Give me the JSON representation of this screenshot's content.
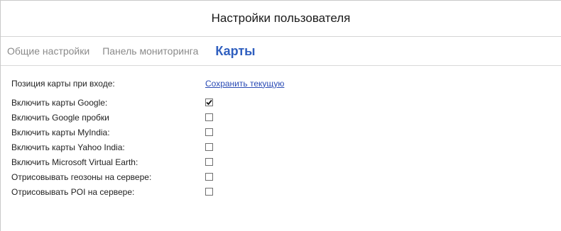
{
  "dialog": {
    "title": "Настройки пользователя"
  },
  "tabs": [
    {
      "label": "Общие настройки",
      "active": false
    },
    {
      "label": "Панель мониторинга",
      "active": false
    },
    {
      "label": "Карты",
      "active": true
    }
  ],
  "map_position": {
    "label": "Позиция карты при входе:",
    "link": "Сохранить текущую"
  },
  "settings": [
    {
      "label": "Включить карты Google:",
      "checked": true
    },
    {
      "label": "Включить Google пробки",
      "checked": false
    },
    {
      "label": "Включить карты MyIndia:",
      "checked": false
    },
    {
      "label": "Включить карты Yahoo India:",
      "checked": false
    },
    {
      "label": "Включить Microsoft Virtual Earth:",
      "checked": false
    },
    {
      "label": "Отрисовывать геозоны на сервере:",
      "checked": false
    },
    {
      "label": "Отрисовывать POI на сервере:",
      "checked": false
    }
  ],
  "colors": {
    "active_tab": "#2f5fbf",
    "inactive_tab": "#8a8a8a",
    "link": "#2a4bb5"
  },
  "icons": {
    "checkbox_checked": "checkmark-icon"
  }
}
